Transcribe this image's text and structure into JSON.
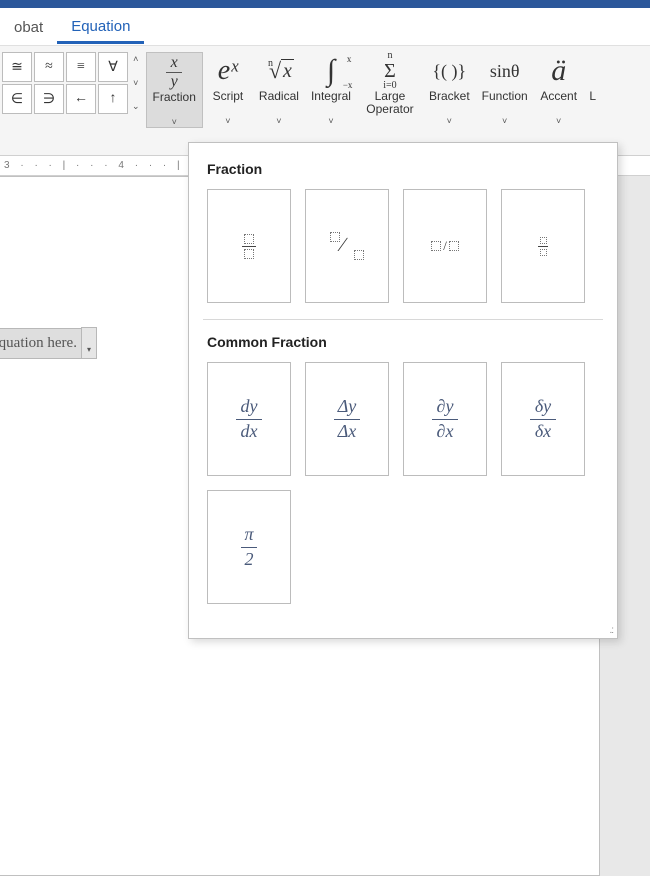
{
  "tabs": {
    "left": "obat",
    "active": "Equation"
  },
  "symbols": {
    "row1": [
      "≅",
      "≈",
      "≡",
      "∀"
    ],
    "row2": [
      "∈",
      "∋",
      "←",
      "↑"
    ]
  },
  "structures": [
    {
      "key": "fraction",
      "label": "Fraction"
    },
    {
      "key": "script",
      "label": "Script"
    },
    {
      "key": "radical",
      "label": "Radical"
    },
    {
      "key": "integral",
      "label": "Integral"
    },
    {
      "key": "large_operator",
      "label": "Large\nOperator"
    },
    {
      "key": "bracket",
      "label": "Bracket"
    },
    {
      "key": "function",
      "label": "Function"
    },
    {
      "key": "accent",
      "label": "Accent"
    },
    {
      "key": "limit",
      "label": "L"
    }
  ],
  "struct_icons": {
    "script": "eˣ",
    "function": "sinθ",
    "bracket": "{( )}",
    "accent": "ä",
    "integral_sub": "−x",
    "integral_sup": "x",
    "sigma_sub": "i=0",
    "sigma_sup": "n",
    "radical_index": "n"
  },
  "ruler": {
    "marks": "3 · · · | · · · 4 · · · | · · ·"
  },
  "equation_placeholder": {
    "text": "equation here."
  },
  "gallery": {
    "sections": [
      {
        "title": "Fraction",
        "items": [
          {
            "kind": "stacked"
          },
          {
            "kind": "skewed"
          },
          {
            "kind": "linear"
          },
          {
            "kind": "small"
          }
        ]
      },
      {
        "title": "Common Fraction",
        "items": [
          {
            "num": "dy",
            "den": "dx"
          },
          {
            "num": "Δy",
            "den": "Δx"
          },
          {
            "num": "∂y",
            "den": "∂x"
          },
          {
            "num": "δy",
            "den": "δx"
          },
          {
            "num": "π",
            "den": "2"
          }
        ]
      }
    ]
  }
}
